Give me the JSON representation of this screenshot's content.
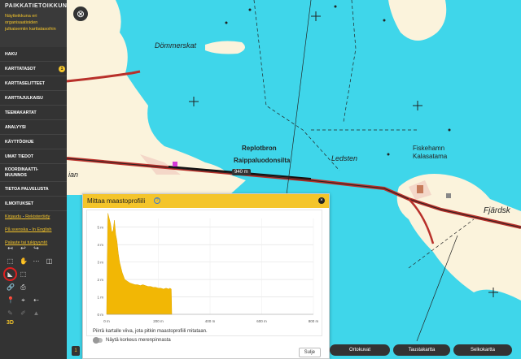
{
  "sidebar": {
    "brand": "PAIKKATIETOIKKUNA",
    "tagline": [
      "Näytteikkuna eri",
      "organisaatioiden",
      "julkaisemiin karttatasoihin"
    ],
    "menu": [
      {
        "label": "HAKU"
      },
      {
        "label": "KARTTATASOT",
        "badge": "1"
      },
      {
        "label": "KARTTASELITTEET"
      },
      {
        "label": "KARTTAJULKAISU"
      },
      {
        "label": "TEEMAKARTAT"
      },
      {
        "label": "ANALYYSI"
      },
      {
        "label": "KÄYTTÖOHJE"
      },
      {
        "label": "UMAT TIEDOT"
      },
      {
        "label": "KOORDINAATTI-\nMUUNNOS"
      },
      {
        "label": "TIETOA PALVELUSTA"
      },
      {
        "label": "ILMOITUKSET"
      }
    ],
    "links": {
      "login": "Kirjaudu",
      "separator": " - ",
      "register": "Rekisteröidy",
      "swedish": "På svenska",
      "english": "In English",
      "feedback": "Palaute tai tukipyyntö"
    },
    "tools_3d": "3D"
  },
  "map": {
    "labels": {
      "dommerskat": "Dömmerskat",
      "replotbron": "Replotbron",
      "raippaluodonsilta": "Raippaluodonsilta",
      "ledsten": "Ledsten",
      "fiskehamn": "Fiskehamn",
      "kalasatama": "Kalasatama",
      "fjardsk": "Fjärdsk",
      "ian": "ian"
    },
    "distance_badge": "940 m",
    "colors": {
      "water": "#3fd6ea",
      "land": "#fbf3dc",
      "road": "#b8302a"
    }
  },
  "panel": {
    "title": "Mittaa maastoprofiili",
    "help_icon": "?",
    "close_icon": "×",
    "instruction": "Piirrä kartalle viiva, jota pitkin maastoprofiili mitataan.",
    "toggle_label": "Näytä korkeus merenpinnasta",
    "close_button": "Sulje"
  },
  "chart_data": {
    "type": "area",
    "x": [
      0,
      5,
      10,
      15,
      20,
      25,
      30,
      35,
      40,
      45,
      50,
      60,
      70,
      80,
      90,
      100,
      110,
      120,
      130,
      140,
      150,
      160,
      170,
      180,
      190,
      200,
      210,
      220,
      230,
      240,
      245,
      250,
      252
    ],
    "values": [
      0,
      5.8,
      5.5,
      5.2,
      4.7,
      4.8,
      5.4,
      4.6,
      4.2,
      3.5,
      3.0,
      2.4,
      2.0,
      1.9,
      1.8,
      1.75,
      1.7,
      1.7,
      1.65,
      1.7,
      1.65,
      1.6,
      1.6,
      1.55,
      1.55,
      1.5,
      1.5,
      1.45,
      1.5,
      1.45,
      1.5,
      1.45,
      0
    ],
    "color": "#f2b705",
    "ytick_labels": [
      "0 m",
      "1 m",
      "2 m",
      "3 m",
      "4 m",
      "5 m"
    ],
    "xtick_labels": [
      "0 m",
      "200 m",
      "400 m",
      "600 m",
      "800 m"
    ],
    "xlim": [
      0,
      800
    ],
    "ylim": [
      0,
      5.5
    ],
    "grid": true
  },
  "basemaps": {
    "ortho": "Ortokuvat",
    "background": "Taustakartta",
    "guide": "Selkokartta"
  },
  "bottom_left_label": "1"
}
